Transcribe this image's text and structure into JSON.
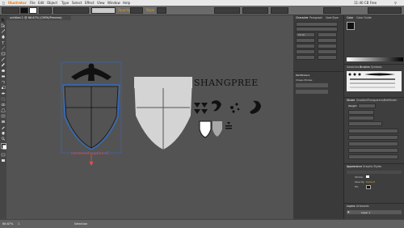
{
  "menubar": {
    "app_name": "Illustrator",
    "items": [
      "File",
      "Edit",
      "Object",
      "Type",
      "Select",
      "Effect",
      "View",
      "Window",
      "Help"
    ],
    "clock": "11:40 CB Free"
  },
  "control_bar": {
    "opacity_label": "Opacity",
    "style_label": "Style"
  },
  "document_tab": {
    "title": "untitled-1 @ 66.67% (CMYK/Preview)"
  },
  "artwork": {
    "wordmark": "SHANGPREE",
    "annotation": "command+option+C"
  },
  "panels": {
    "color_tabs": [
      "Color",
      "Color Guide"
    ],
    "swatch_tabs": [
      "Swatches",
      "Brushes",
      "Symbols"
    ],
    "stroke_tabs": [
      "Stroke",
      "Gradient",
      "Transparency",
      "Pathfinder"
    ],
    "weight_label": "Weight:",
    "appearance_tabs": [
      "Appearance",
      "Graphic Styles"
    ],
    "layers_tabs": [
      "Layers",
      "Artboards"
    ],
    "layer_name": "Layer 1",
    "character_tabs": [
      "Character",
      "Paragraph",
      "OpenType"
    ],
    "pathfinder_label": "Pathfinders:",
    "shape_modes_label": "Shape Modes:",
    "font_size_value": "12 pt",
    "default_label": "Default",
    "stroke_label": "Stroke:",
    "fill_label": "Fill:",
    "opacity_label": "Opacity:"
  },
  "statusbar": {
    "zoom": "66.67%",
    "page": "1",
    "tool": "Selection"
  },
  "colors": {
    "canvas": "#535353",
    "panel": "#3e3e3e",
    "selection": "#2c6fd6",
    "annotation": "#e05252",
    "shape_fill": "#d4d4d4"
  }
}
